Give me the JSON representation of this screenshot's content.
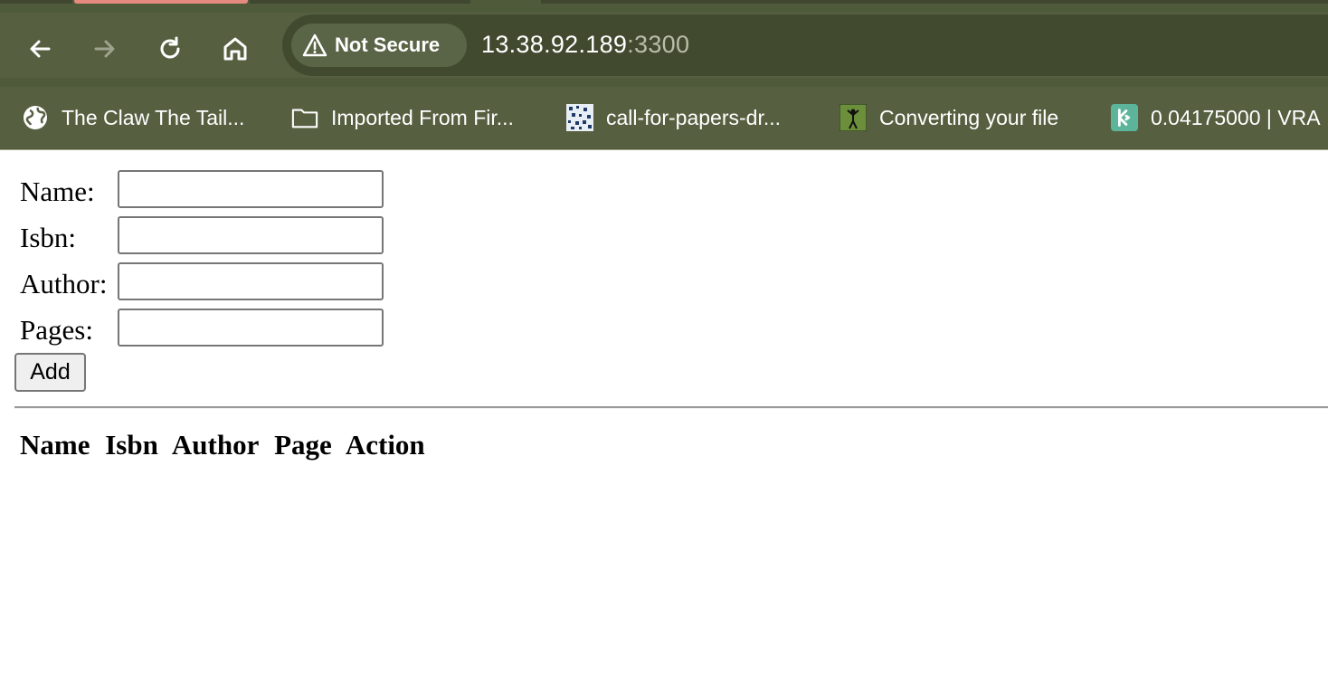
{
  "browser": {
    "security_label": "Not Secure",
    "url_host": "13.38.92.189",
    "url_port": ":3300",
    "bookmarks": [
      {
        "icon": "globe-icon",
        "label": "The Claw The Tail..."
      },
      {
        "icon": "folder-icon",
        "label": "Imported From Fir..."
      },
      {
        "icon": "pattern-favicon",
        "label": "call-for-papers-dr..."
      },
      {
        "icon": "figure-favicon",
        "label": "Converting your file"
      },
      {
        "icon": "kucoin-favicon",
        "label": "0.04175000 | VRA"
      }
    ]
  },
  "form": {
    "fields": [
      {
        "label": "Name:",
        "value": ""
      },
      {
        "label": "Isbn:",
        "value": ""
      },
      {
        "label": "Author:",
        "value": ""
      },
      {
        "label": "Pages:",
        "value": ""
      }
    ],
    "add_label": "Add"
  },
  "table": {
    "headers": [
      "Name",
      "Isbn",
      "Author",
      "Page",
      "Action"
    ]
  }
}
